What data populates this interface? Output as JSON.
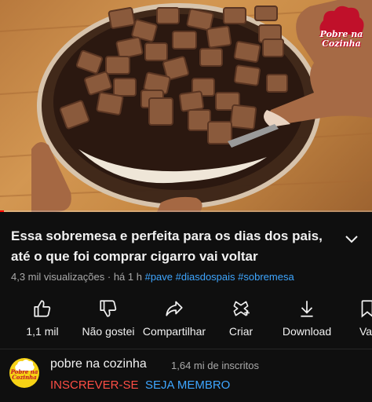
{
  "video": {
    "watermark_text": "Pobre na Cozinha",
    "progress_fraction": 0.01
  },
  "title": {
    "line1": "Essa sobremesa e perfeita para os dias dos pais,",
    "line2": "até o que foi comprar cigarro vai voltar"
  },
  "meta": {
    "views": "4,3 mil visualizações",
    "separator": "·",
    "age": "há 1 h",
    "hashtags": [
      "#pave",
      "#diasdospais",
      "#sobremesa"
    ]
  },
  "actions": {
    "like": {
      "label": "1,1 mil",
      "icon": "thumbs-up-icon"
    },
    "dislike": {
      "label": "Não gostei",
      "icon": "thumbs-down-icon"
    },
    "share": {
      "label": "Compartilhar",
      "icon": "share-icon"
    },
    "create": {
      "label": "Criar",
      "icon": "create-icon"
    },
    "download": {
      "label": "Download",
      "icon": "download-icon"
    },
    "save": {
      "label": "Va",
      "icon": "save-icon"
    }
  },
  "channel": {
    "name": "pobre na cozinha",
    "subscribers": "1,64 mi de inscritos",
    "subscribe_label": "INSCREVER-SE",
    "join_label": "SEJA MEMBRO",
    "avatar_text": "Pobre na Cozinha"
  },
  "colors": {
    "background": "#0f0f0f",
    "text": "#f1f1f1",
    "secondary_text": "#aaaaaa",
    "link": "#3ea6ff",
    "subscribe": "#ff4e45"
  }
}
